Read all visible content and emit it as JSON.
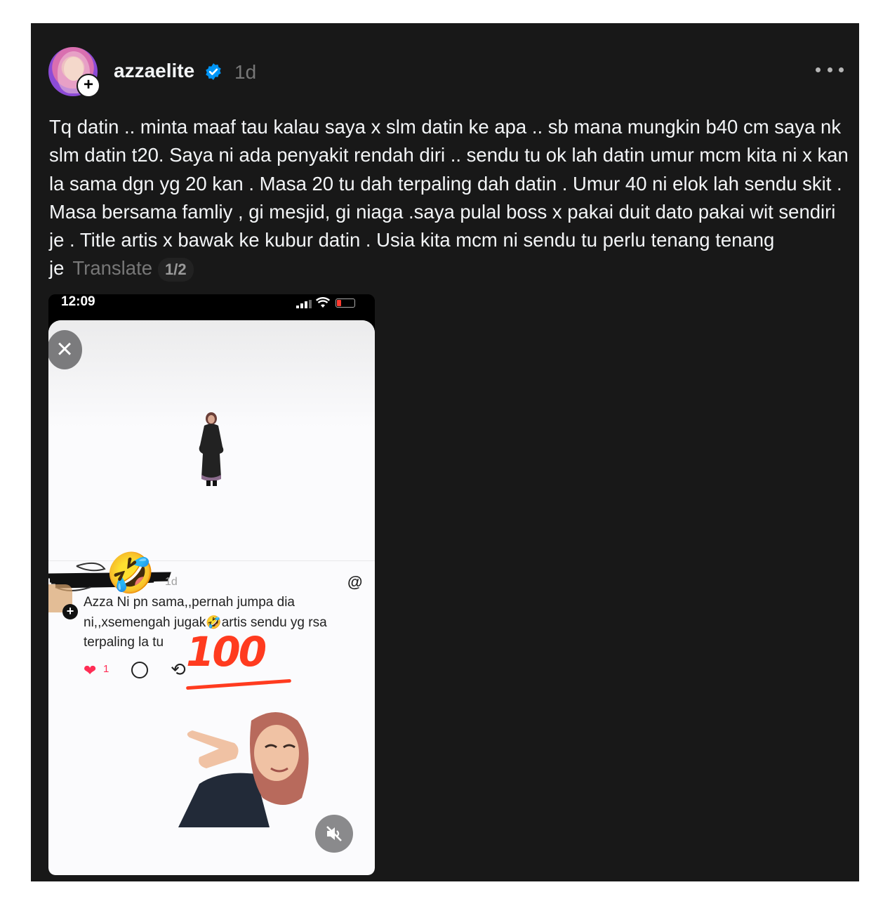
{
  "post": {
    "username": "azzaelite",
    "time_ago": "1d",
    "body": "Tq datin .. minta maaf tau kalau saya x slm datin ke apa .. sb mana mungkin b40 cm saya nk slm datin t20. Saya ni ada penyakit rendah diri .. sendu tu ok lah datin umur mcm kita ni x kan la sama dgn yg 20 kan . Masa 20 tu dah terpaling dah datin . Umur 40 ni elok lah sendu skit . Masa bersama famliy , gi mesjid, gi niaga .saya pulal boss x pakai duit dato pakai wit sendiri je . Title artis x bawak ke kubur datin . Usia kita mcm ni sendu tu perlu tenang tenang je",
    "translate_label": "Translate",
    "media_pager": "1/2"
  },
  "media": {
    "status_time": "12:09",
    "close_symbol": "×",
    "tiny_time": "1d",
    "threads_symbol": "@",
    "plus_symbol": "+",
    "comment_part1": "Azza Ni pn sama,,pernah jumpa dia ni,,xsemengah jugak",
    "comment_emoji": "🤣",
    "comment_part2": "artis sendu yg rsa terpaling la tu",
    "like_count": "1",
    "heart_symbol": "❤",
    "repost_symbol": "⟲",
    "laugh_sticker": "🤣",
    "hundred_sticker": "100"
  },
  "colors": {
    "card_bg": "#181818",
    "text": "#f3f5f7",
    "muted": "#777777",
    "verified": "#0095f6",
    "like": "#ff2d55",
    "hundred": "#ff3b1f"
  },
  "icons": [
    "avatar",
    "follow-plus-icon",
    "verified-badge-icon",
    "more-options-icon",
    "close-icon",
    "threads-logo-icon",
    "heart-icon",
    "reply-icon",
    "repost-icon",
    "mute-icon",
    "signal-icon",
    "wifi-icon",
    "battery-icon"
  ]
}
